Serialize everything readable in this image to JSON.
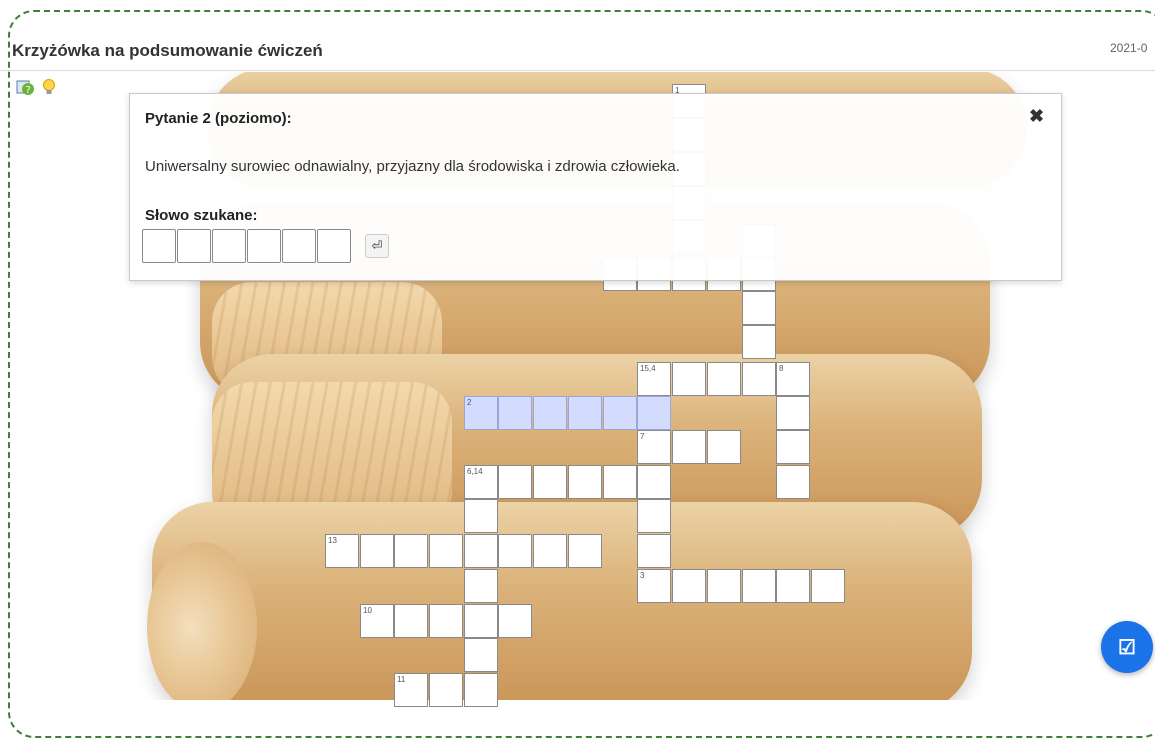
{
  "header": {
    "title": "Krzyżówka na podsumowanie ćwiczeń",
    "date": "2021-0"
  },
  "tools": [
    {
      "icon": "help-question-icon"
    },
    {
      "icon": "lightbulb-hint-icon"
    }
  ],
  "popup": {
    "title": "Pytanie 2 (poziomo):",
    "question": "Uniwersalny surowiec odnawialny, przyjazny dla środowiska i zdrowia człowieka.",
    "answer_label": "Słowo szukane:",
    "answer_length": 6,
    "enter_symbol": "⏎",
    "close_symbol": "✖"
  },
  "crossword": {
    "numbers": {
      "n15_4": "15,4",
      "n8": "8",
      "n2": "2",
      "n7": "7",
      "n6_14": "6,14",
      "n13": "13",
      "n3": "3",
      "n10": "10",
      "n11": "11",
      "n1": "1"
    }
  },
  "colors": {
    "highlight": "#d3dbff",
    "accent": "#1a73e8",
    "frame": "#3f7f3a"
  },
  "check_button_icon": "check-square-icon"
}
